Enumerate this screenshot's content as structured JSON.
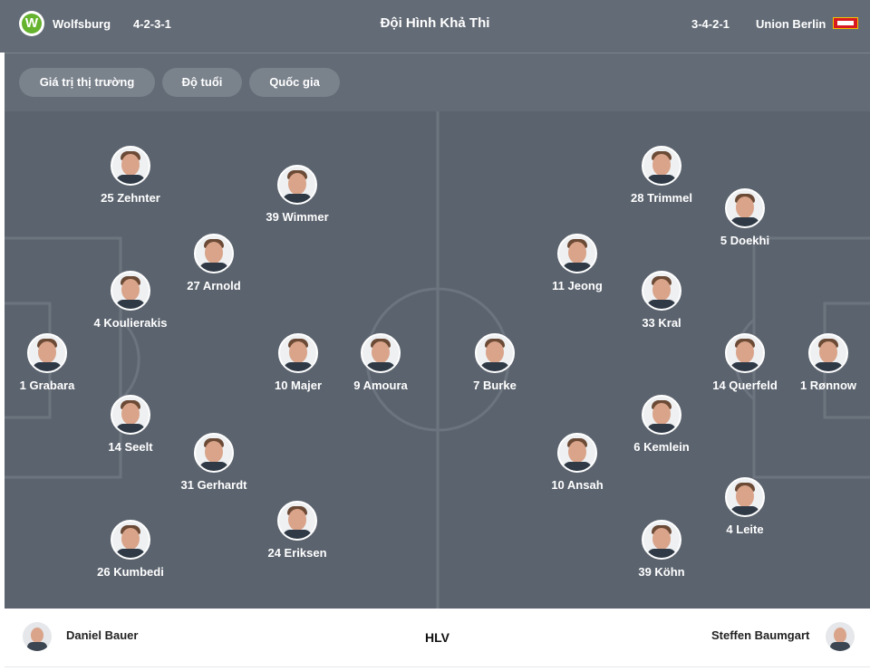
{
  "header": {
    "title": "Đội Hình Khả Thi",
    "home": {
      "name": "Wolfsburg",
      "formation": "4-2-3-1",
      "logo_letter": "W"
    },
    "away": {
      "name": "Union Berlin",
      "formation": "3-4-2-1"
    }
  },
  "filters": [
    "Giá trị thị trường",
    "Độ tuổi",
    "Quốc gia"
  ],
  "home_players": [
    {
      "label": "25 Zehnter"
    },
    {
      "label": "39 Wimmer"
    },
    {
      "label": "27 Arnold"
    },
    {
      "label": "4 Koulierakis"
    },
    {
      "label": "1 Grabara"
    },
    {
      "label": "10 Majer"
    },
    {
      "label": "9 Amoura"
    },
    {
      "label": "14 Seelt"
    },
    {
      "label": "31 Gerhardt"
    },
    {
      "label": "24 Eriksen"
    },
    {
      "label": "26 Kumbedi"
    }
  ],
  "away_players": [
    {
      "label": "28 Trimmel"
    },
    {
      "label": "5 Doekhi"
    },
    {
      "label": "11 Jeong"
    },
    {
      "label": "33 Kral"
    },
    {
      "label": "7 Burke"
    },
    {
      "label": "14 Querfeld"
    },
    {
      "label": "1 Rønnow"
    },
    {
      "label": "6 Kemlein"
    },
    {
      "label": "10 Ansah"
    },
    {
      "label": "4 Leite"
    },
    {
      "label": "39 Köhn"
    }
  ],
  "coaches": {
    "label": "HLV",
    "home": "Daniel Bauer",
    "away": "Steffen Baumgart"
  },
  "colors": {
    "header_bg": "#636b76",
    "pitch_bg": "#5b636e",
    "chip_bg": "#7a828c",
    "wolfsburg_green": "#65b32e",
    "union_red": "#d71920"
  }
}
